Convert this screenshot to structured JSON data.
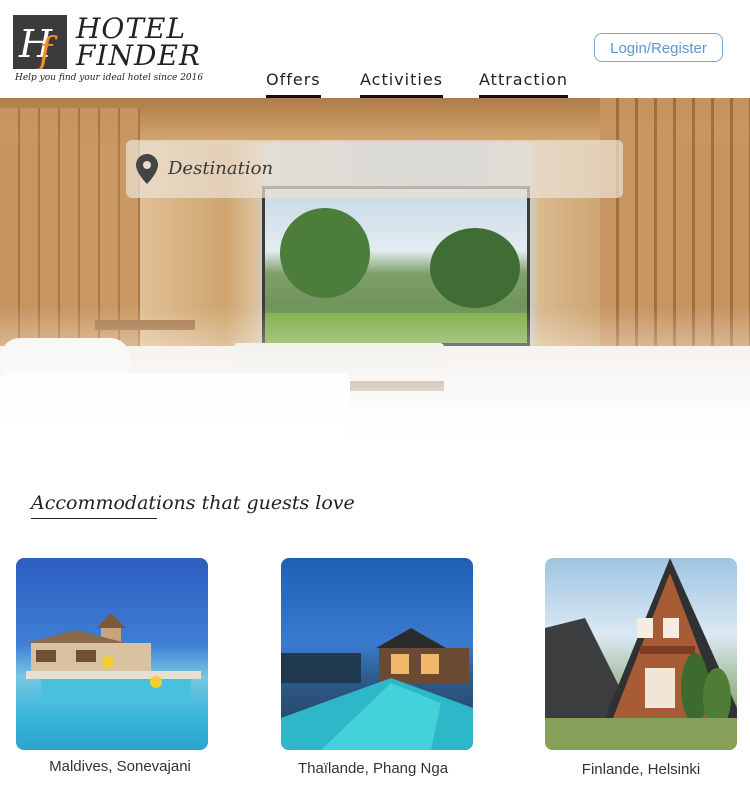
{
  "header": {
    "logo_line1": "HOTEL",
    "logo_line2": "FINDER",
    "tagline": "Help you find your ideal hotel since 2016",
    "login_label": "Login/Register"
  },
  "nav": {
    "items": [
      "Offers",
      "Activities",
      "Attraction"
    ]
  },
  "search": {
    "placeholder": "Destination"
  },
  "section": {
    "title": "Accommodations that guests love"
  },
  "cards": [
    {
      "label": "Maldives, Sonevajani"
    },
    {
      "label": "Thaïlande, Phang Nga"
    },
    {
      "label": "Finlande, Helsinki"
    }
  ],
  "colors": {
    "accent_orange": "#f0902a",
    "link_blue": "#5f95cf"
  }
}
